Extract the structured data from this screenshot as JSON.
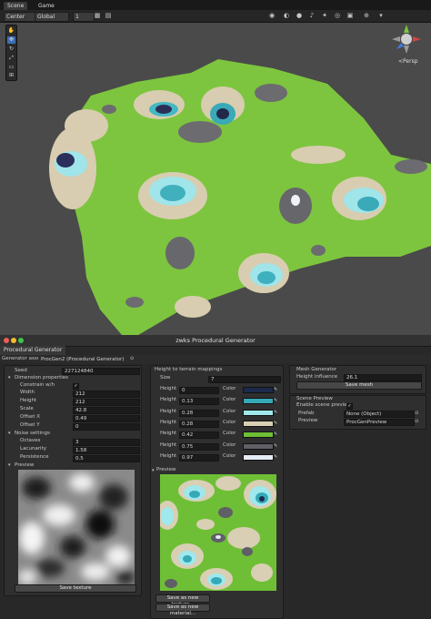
{
  "scene": {
    "tabs": [
      {
        "label": "Scene"
      },
      {
        "label": "Game"
      }
    ],
    "toolbar": {
      "pivot": "Center",
      "space": "Global",
      "snap": "1"
    },
    "persp_label": "<Persp"
  },
  "window": {
    "title": "zwks Procedural Generator",
    "tab_label": "Procedural Generator",
    "asset_label": "Generator asset",
    "asset_value": "ProcGen2 (Procedural Generator)"
  },
  "left": {
    "seed_label": "Seed",
    "seed_value": "227124840",
    "dimension_header": "Dimension properties",
    "constrain_label": "Constrain w/h",
    "width_label": "Width",
    "width_value": "212",
    "height_label": "Height",
    "height_value": "212",
    "scale_label": "Scale",
    "scale_value": "42.8",
    "offsetx_label": "Offset X",
    "offsetx_value": "0.49",
    "offsety_label": "Offset Y",
    "offsety_value": "0",
    "noise_header": "Noise settings",
    "octaves_label": "Octaves",
    "octaves_value": "3",
    "lacunarity_label": "Lacunarity",
    "lacunarity_value": "1.58",
    "persistence_label": "Persistence",
    "persistence_value": "0.5",
    "preview_header": "Preview",
    "save_texture": "Save texture"
  },
  "middle": {
    "header": "Height to terrain mappings",
    "size_label": "Size",
    "size_value": "7",
    "height_label": "Height",
    "color_label": "Color",
    "mappings": [
      {
        "height": "0",
        "color": "#1b2a4a"
      },
      {
        "height": "0.13",
        "color": "#36a9b8"
      },
      {
        "height": "0.28",
        "color": "#9fe8ec"
      },
      {
        "height": "0.28",
        "color": "#d9cfb4"
      },
      {
        "height": "0.42",
        "color": "#6fbf36"
      },
      {
        "height": "0.75",
        "color": "#5f5f66"
      },
      {
        "height": "0.97",
        "color": "#e6ecf6"
      }
    ],
    "preview_header": "Preview",
    "save_new_texture": "Save as new texture...",
    "save_new_material": "Save as new material..."
  },
  "right": {
    "mesh_header": "Mesh Generator",
    "height_influence_label": "Height influence",
    "height_influence_value": "26.1",
    "save_mesh": "Save mesh",
    "scene_preview_header": "Scene Preview",
    "enable_label": "Enable scene preview",
    "prefab_label": "Prefab",
    "prefab_value": "None (Object)",
    "preview_label": "Preview",
    "preview_value": "ProcGenPreview"
  }
}
